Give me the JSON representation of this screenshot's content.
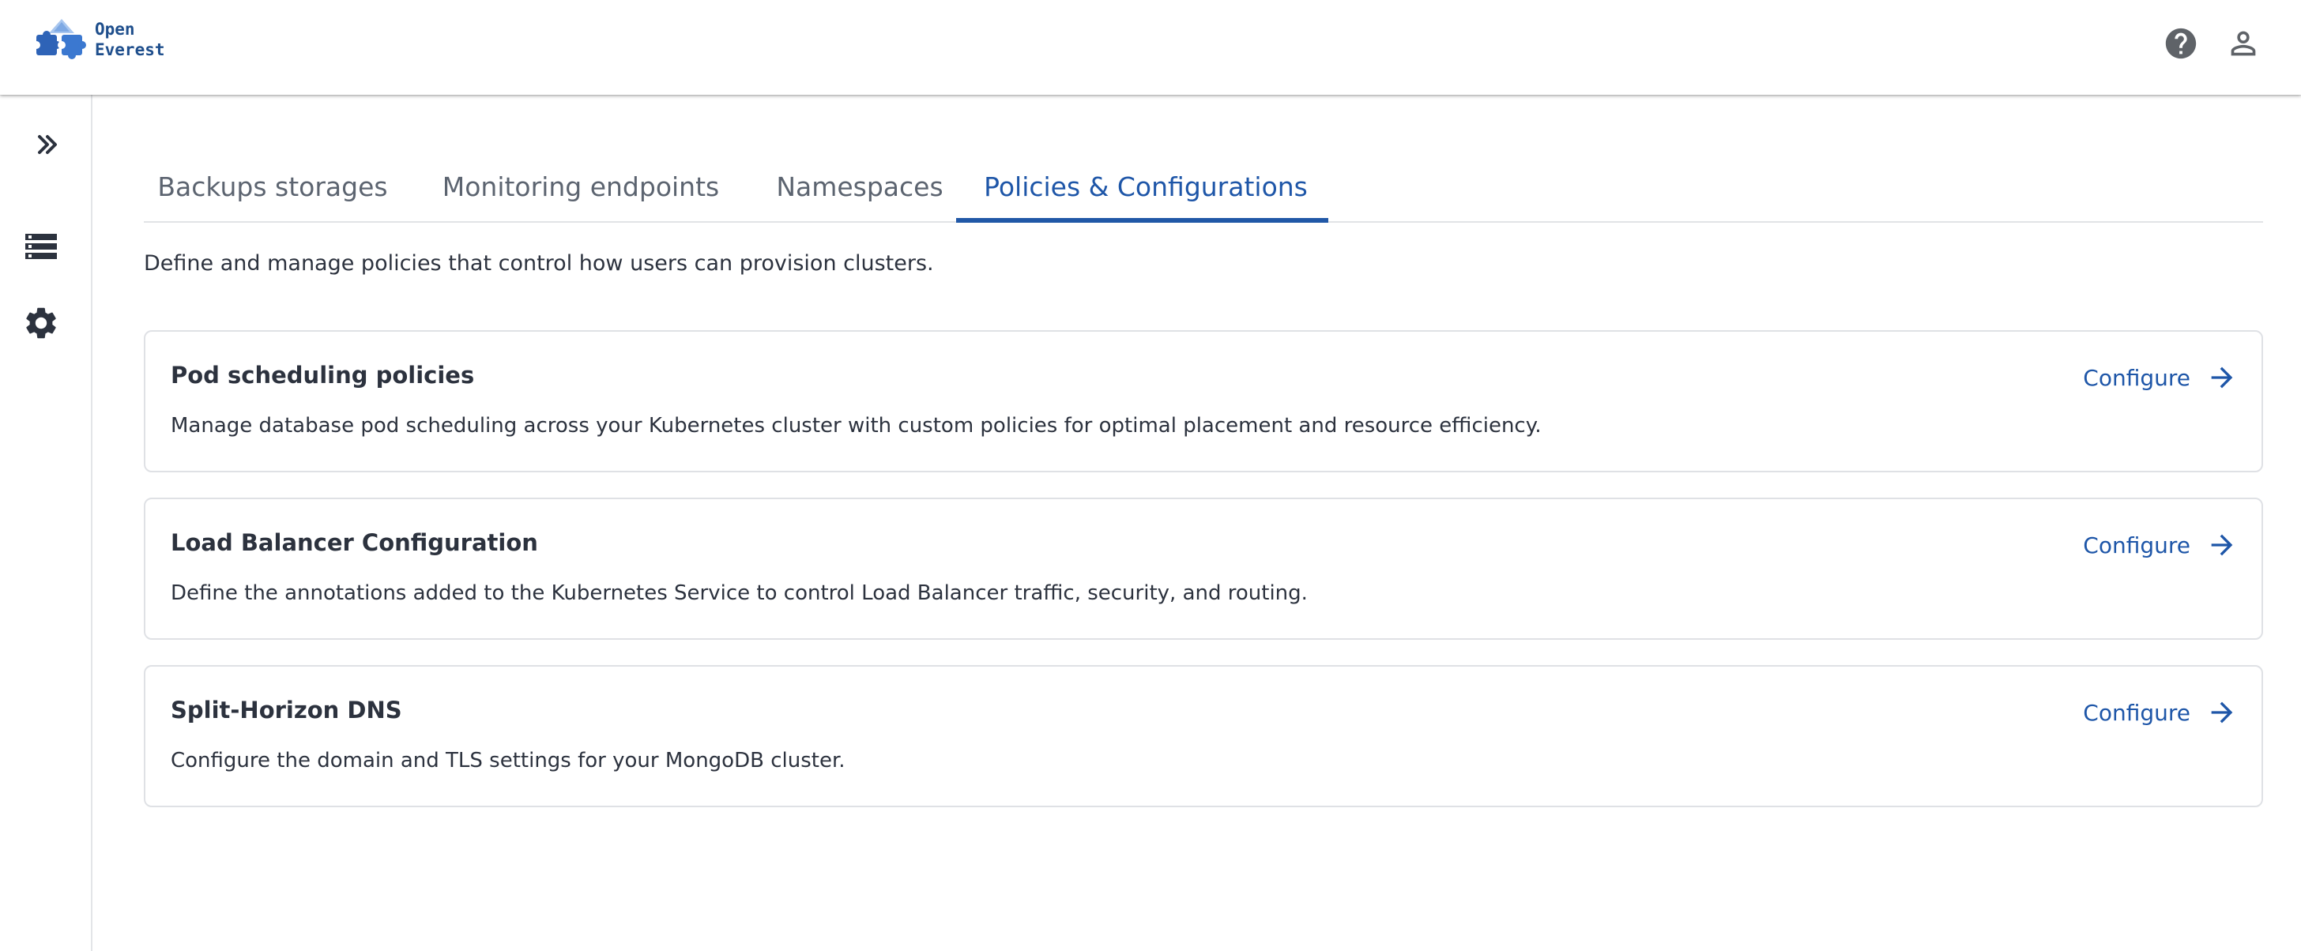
{
  "brand": {
    "name_line1": "Open",
    "name_line2": "Everest",
    "logo_icon": "puzzle-mountain-logo",
    "color": "#1e4e8c"
  },
  "header": {
    "help_icon": "help-circle-icon",
    "user_icon": "person-icon"
  },
  "sidebar": {
    "items": [
      {
        "icon": "double-chevron-right-icon",
        "label": "Expand"
      },
      {
        "icon": "database-storage-icon",
        "label": "Databases"
      },
      {
        "icon": "gear-icon",
        "label": "Settings"
      }
    ]
  },
  "tabs": [
    {
      "label": "Backups storages",
      "active": false
    },
    {
      "label": "Monitoring endpoints",
      "active": false
    },
    {
      "label": "Namespaces",
      "active": false
    },
    {
      "label": "Policies & Configurations",
      "active": true
    }
  ],
  "intro": "Define and manage policies that control how users can provision clusters.",
  "cards": [
    {
      "title": "Pod scheduling policies",
      "description": "Manage database pod scheduling across your Kubernetes cluster with custom policies for optimal placement and resource efficiency.",
      "action": "Configure"
    },
    {
      "title": "Load Balancer Configuration",
      "description": "Define the annotations added to the Kubernetes Service to control Load Balancer traffic, security, and routing.",
      "action": "Configure"
    },
    {
      "title": "Split-Horizon DNS",
      "description": "Configure the domain and TLS settings for your MongoDB cluster.",
      "action": "Configure"
    }
  ],
  "colors": {
    "accent": "#2158a7",
    "text": "#2c323e",
    "tab_inactive": "#5c6470",
    "icon": "#5f6368"
  }
}
